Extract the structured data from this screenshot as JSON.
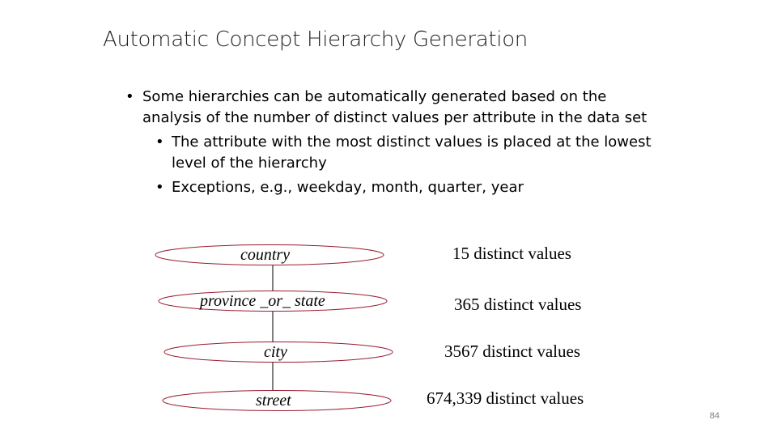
{
  "slide": {
    "title": "Automatic Concept Hierarchy Generation",
    "page_number": "84"
  },
  "bullets": [
    {
      "level": 1,
      "text": "Some hierarchies can be automatically generated based on the analysis of the number of distinct values per attribute in the data set"
    },
    {
      "level": 2,
      "text": "The attribute with the most distinct values is placed at the lowest level of the hierarchy"
    },
    {
      "level": 2,
      "text": "Exceptions, e.g., weekday, month, quarter, year"
    }
  ],
  "hierarchy": [
    {
      "label": "country",
      "count": "15 distinct values"
    },
    {
      "label": "province _or_ state",
      "count": "365 distinct values"
    },
    {
      "label": "city",
      "count": "3567 distinct values"
    },
    {
      "label": "street",
      "count": "674,339 distinct values"
    }
  ],
  "colors": {
    "ellipse_stroke": "#9b1b30",
    "connector": "#000000"
  }
}
